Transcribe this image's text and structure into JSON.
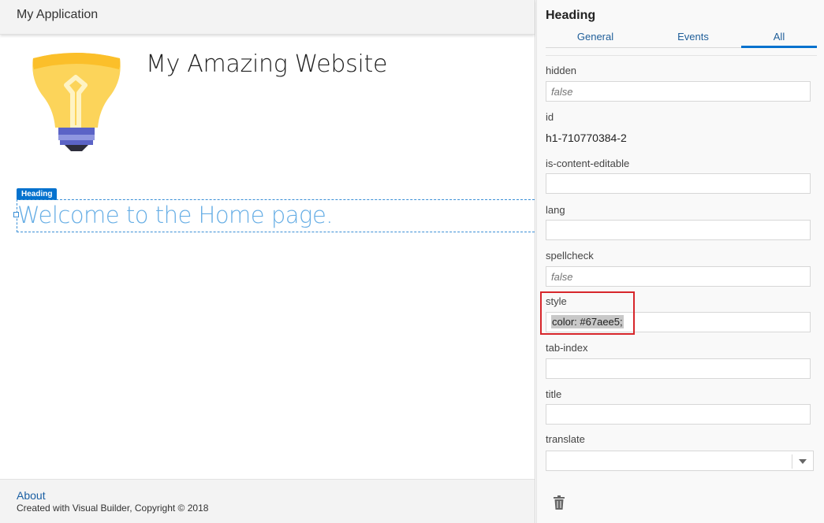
{
  "app": {
    "title": "My Application"
  },
  "canvas": {
    "site_title": "My Amazing Website",
    "logo_icon": "lightbulb-icon",
    "heading_tag": "Heading",
    "heading_text": "Welcome to the Home page.",
    "heading_color": "#67aee5"
  },
  "footer": {
    "about": "About",
    "copyright": "Created with Visual Builder, Copyright © 2018"
  },
  "panel": {
    "title": "Heading",
    "tabs": [
      {
        "label": "General"
      },
      {
        "label": "Events"
      },
      {
        "label": "All"
      }
    ],
    "active_tab": "All",
    "properties": {
      "hidden": {
        "label": "hidden",
        "placeholder": "false",
        "value": ""
      },
      "id": {
        "label": "id",
        "value": "h1-710770384-2"
      },
      "is_content_editable": {
        "label": "is-content-editable",
        "value": ""
      },
      "lang": {
        "label": "lang",
        "value": ""
      },
      "spellcheck": {
        "label": "spellcheck",
        "placeholder": "false",
        "value": ""
      },
      "style": {
        "label": "style",
        "value": "color: #67aee5;"
      },
      "tab_index": {
        "label": "tab-index",
        "value": ""
      },
      "title": {
        "label": "title",
        "value": ""
      },
      "translate": {
        "label": "translate",
        "value": ""
      }
    },
    "delete_icon": "trash-icon"
  },
  "colors": {
    "accent": "#0572ce",
    "highlight_box": "#d7262b",
    "link": "#1a5fa3"
  }
}
